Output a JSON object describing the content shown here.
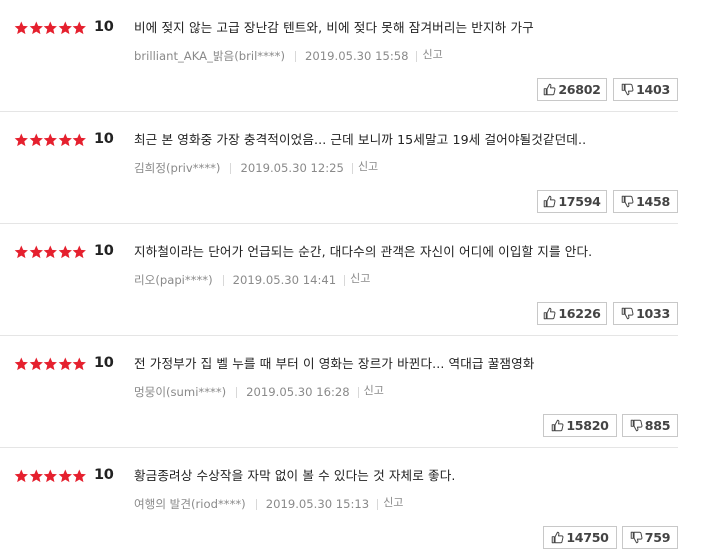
{
  "colors": {
    "star": "#e5202e",
    "text": "#222222",
    "meta": "#8a8a8a",
    "border": "#c8c8c8"
  },
  "icons": {
    "star": "star-icon",
    "like": "thumbs-up-icon",
    "dislike": "thumbs-down-icon"
  },
  "reviews": [
    {
      "score": "10",
      "rating_stars": 5,
      "text": "비에 젖지 않는 고급 장난감 텐트와, 비에 젖다 못해 잠겨버리는 반지하 가구",
      "author": "brilliant_AKA_밝음(bril****)",
      "date": "2019.05.30 15:58",
      "report_label": "신고",
      "likes": "26802",
      "dislikes": "1403"
    },
    {
      "score": "10",
      "rating_stars": 5,
      "text": "최근 본 영화중 가장 충격적이었음... 근데 보니까 15세말고 19세 걸어야될것같던데..",
      "author": "김희정(priv****)",
      "date": "2019.05.30 12:25",
      "report_label": "신고",
      "likes": "17594",
      "dislikes": "1458"
    },
    {
      "score": "10",
      "rating_stars": 5,
      "text": "지하철이라는 단어가 언급되는 순간, 대다수의 관객은 자신이 어디에 이입할 지를 안다.",
      "author": "리오(papi****)",
      "date": "2019.05.30 14:41",
      "report_label": "신고",
      "likes": "16226",
      "dislikes": "1033"
    },
    {
      "score": "10",
      "rating_stars": 5,
      "text": "전 가정부가 집 벨 누를 때 부터 이 영화는 장르가 바뀐다... 역대급 꿀잼영화",
      "author": "멍뭉이(sumi****)",
      "date": "2019.05.30 16:28",
      "report_label": "신고",
      "likes": "15820",
      "dislikes": "885"
    },
    {
      "score": "10",
      "rating_stars": 5,
      "text": "황금종려상 수상작을 자막 없이 볼 수 있다는 것 자체로 좋다.",
      "author": "여행의 발견(riod****)",
      "date": "2019.05.30 15:13",
      "report_label": "신고",
      "likes": "14750",
      "dislikes": "759"
    }
  ]
}
